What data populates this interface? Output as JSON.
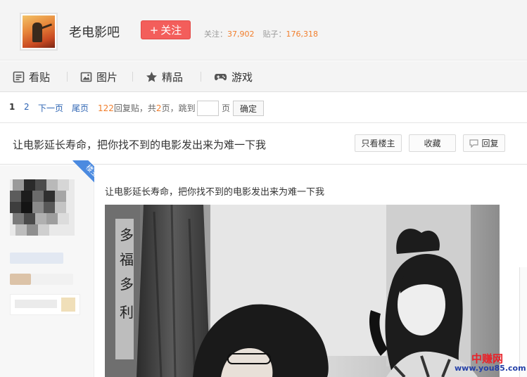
{
  "forum": {
    "name": "老电影吧",
    "follow_label": "关注",
    "follow_plus": "+",
    "stats": {
      "followers_label": "关注：",
      "followers": "37,902",
      "posts_label": "贴子：",
      "posts": "176,318"
    }
  },
  "nav": {
    "items": [
      {
        "label": "看贴",
        "icon": "post-list-icon"
      },
      {
        "label": "图片",
        "icon": "image-icon"
      },
      {
        "label": "精品",
        "icon": "star-icon"
      },
      {
        "label": "游戏",
        "icon": "gamepad-icon"
      }
    ]
  },
  "pager": {
    "current": "1",
    "page2": "2",
    "next": "下一页",
    "last": "尾页",
    "reply_count": "122",
    "reply_suffix": "回复贴，共",
    "page_count": "2",
    "page_suffix": "页，跳到",
    "page_unit": "页",
    "go_label": "确定",
    "jump_value": ""
  },
  "thread": {
    "title": "让电影延长寿命，把你找不到的电影发出来为难一下我",
    "only_op_label": "只看楼主",
    "favorite_label": "收藏",
    "reply_label": "回复"
  },
  "post": {
    "op_badge": "楼主",
    "text": "让电影延长寿命，把你找不到的电影发出来为难一下我"
  },
  "watermark": {
    "brand": "中赚网",
    "url": "www.you85.com"
  },
  "colors": {
    "follow_button": "#f35e5b",
    "stat_number": "#f17e2c",
    "link": "#2d64b3",
    "op_badge": "#4b8ae0"
  }
}
